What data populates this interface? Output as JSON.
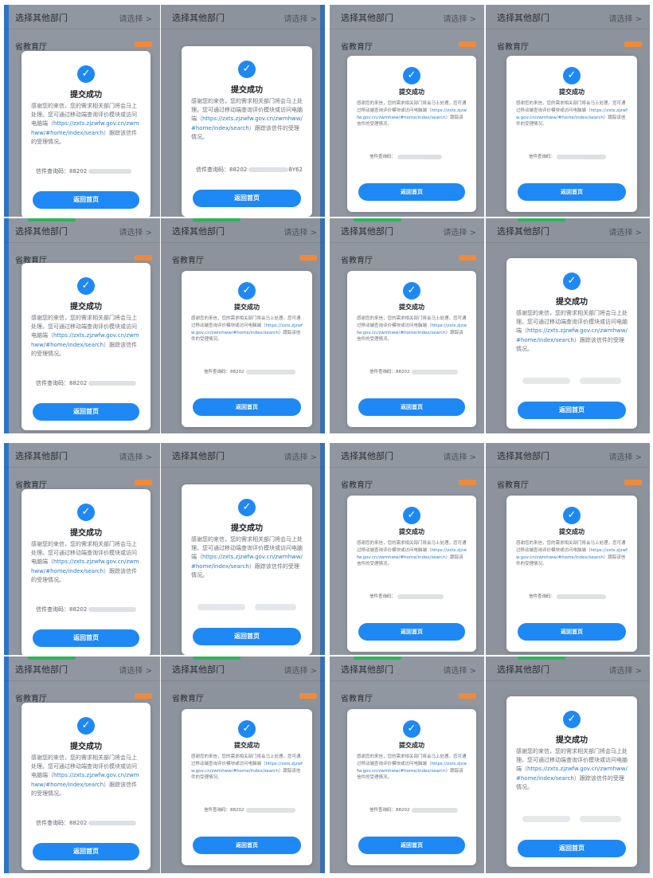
{
  "ui": {
    "other_dept": "选择其他部门",
    "pick": "请选择 >",
    "dept": "省教育厅",
    "success_title": "提交成功",
    "msg_lead": "感谢您的来信，您的需求相关部门将会马上处理。您可通过移动端查询评价模块或访问电脑端（",
    "msg_link": "https://zxts.zjzwfw.gov.cn/zwmhww/#home/index/search",
    "msg_tail": "）跟踪该信件的受理情况。",
    "query_label": "信件查询码：",
    "code_8820": "88202",
    "code_y62": "8Y62",
    "back_home": "返回首页"
  },
  "colors": {
    "accent": "#1e88f5",
    "badge": "#f08a3a",
    "link": "#2a7ccb",
    "strip_blue": "#2d74c8",
    "strip_green": "#2eb45c"
  },
  "icons": {
    "check": "check-circle-icon"
  }
}
